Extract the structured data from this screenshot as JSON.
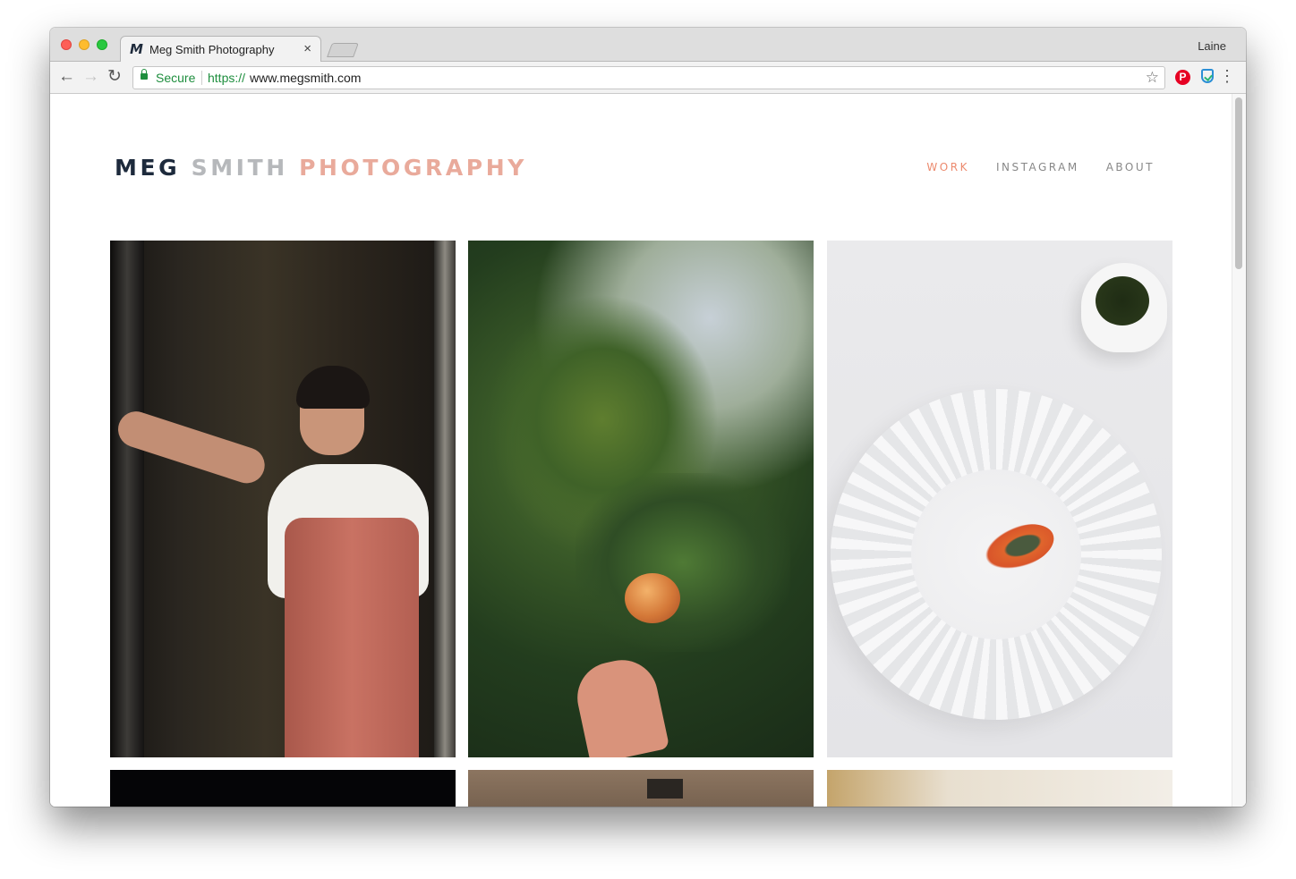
{
  "browser": {
    "tab": {
      "favicon": "M",
      "title": "Meg Smith Photography",
      "close": "×"
    },
    "profile": "Laine",
    "omnibox": {
      "security_label": "Secure",
      "url_scheme": "https://",
      "url_host": "www.megsmith.com"
    },
    "nav_icons": {
      "back": "←",
      "forward": "→",
      "reload": "↻",
      "star": "☆",
      "menu": "⋮"
    },
    "extensions": {
      "pinterest": "P"
    }
  },
  "site": {
    "logo": {
      "word1": "MEG",
      "word2": "SMITH",
      "word3": "PHOTOGRAPHY"
    },
    "nav": [
      {
        "label": "WORK",
        "active": true
      },
      {
        "label": "INSTAGRAM",
        "active": false
      },
      {
        "label": "ABOUT",
        "active": false
      }
    ],
    "gallery_row1": [
      "chef-portrait-photo",
      "peach-tree-photo",
      "plated-dish-photo"
    ],
    "gallery_row2": [
      "dark-photo",
      "wooden-door-photo",
      "outdoor-photo"
    ]
  },
  "colors": {
    "nav_active": "#ec8a6e",
    "logo_dark": "#1d2a3c",
    "secure_green": "#1e8e3e"
  }
}
